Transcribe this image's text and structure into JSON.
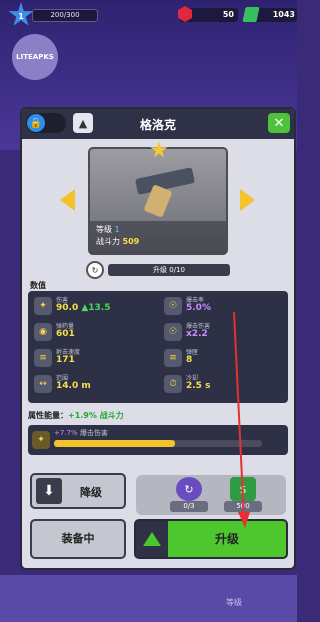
{
  "colors": {
    "accent_green": "#4ec72e",
    "gold": "#f2c32a",
    "panel_dark": "#2f3246",
    "annotation_red": "#e83030"
  },
  "hud": {
    "level": "1",
    "xp": "200/300",
    "gems": "50",
    "cash": "1043"
  },
  "brand": {
    "text": "LITEAPKS"
  },
  "panel": {
    "title": "格洛克",
    "lock_icon": "lock-icon",
    "skin_icon": "shirt-icon",
    "close_label": "✕"
  },
  "weapon": {
    "level_label": "等级",
    "level_value": "1",
    "power_label": "战斗力",
    "power_value": "509",
    "upgrade_progress": "升级 0/10"
  },
  "stats": {
    "section_label": "数值",
    "items": [
      {
        "name": "伤害",
        "value": "90.0",
        "bonus": "13.5",
        "icon": "damage-icon"
      },
      {
        "name": "爆击率",
        "value": "5.0%",
        "icon": "crit-rate-icon"
      },
      {
        "name": "弹药量",
        "value": "601",
        "icon": "ammo-icon"
      },
      {
        "name": "爆击伤害",
        "value": "x2.2",
        "icon": "crit-damage-icon"
      },
      {
        "name": "射击速度",
        "value": "171",
        "icon": "fire-rate-icon"
      },
      {
        "name": "弹匣",
        "value": "8",
        "icon": "magazine-icon"
      },
      {
        "name": "范围",
        "value": "14.0 m",
        "icon": "range-icon"
      },
      {
        "name": "冷却",
        "value": "2.5 s",
        "icon": "reload-icon"
      }
    ]
  },
  "boost": {
    "label": "属性能量：",
    "value": "+1.9% 战斗力",
    "detail_value": "+7.7%",
    "detail_name": "爆击伤害",
    "progress": 0.58
  },
  "buttons": {
    "downgrade": "降级",
    "equipped": "装备中",
    "upgrade": "升级"
  },
  "costs": [
    {
      "icon": "weapon-part-icon",
      "count": "0/3"
    },
    {
      "icon": "cash-icon",
      "count": "500"
    }
  ],
  "bottom_nav": {
    "label": "等级"
  }
}
